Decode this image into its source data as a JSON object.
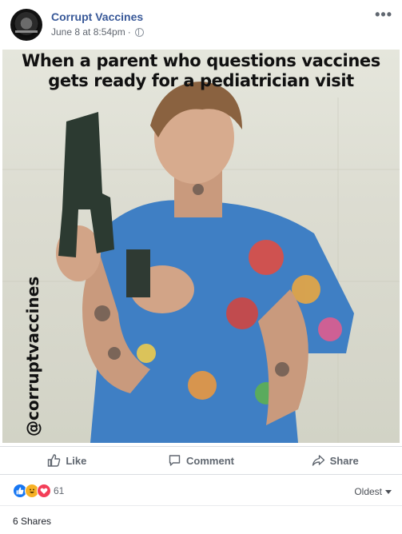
{
  "post": {
    "page_name": "Corrupt Vaccines",
    "timestamp": "June 8 at 8:54pm",
    "separator": "·",
    "more_label": "•••"
  },
  "image": {
    "caption_line1": "When a parent who questions vaccines",
    "caption_line2": "gets ready for a pediatrician visit",
    "watermark": "@corruptvaccines"
  },
  "actions": {
    "like": "Like",
    "comment": "Comment",
    "share": "Share"
  },
  "reactions": {
    "count": "61",
    "sort_label": "Oldest"
  },
  "shares": {
    "label": "6 Shares"
  },
  "colors": {
    "link_blue": "#385898",
    "like_blue": "#1877f2",
    "haha_yellow": "#f7b125",
    "love_red": "#f33e58"
  }
}
